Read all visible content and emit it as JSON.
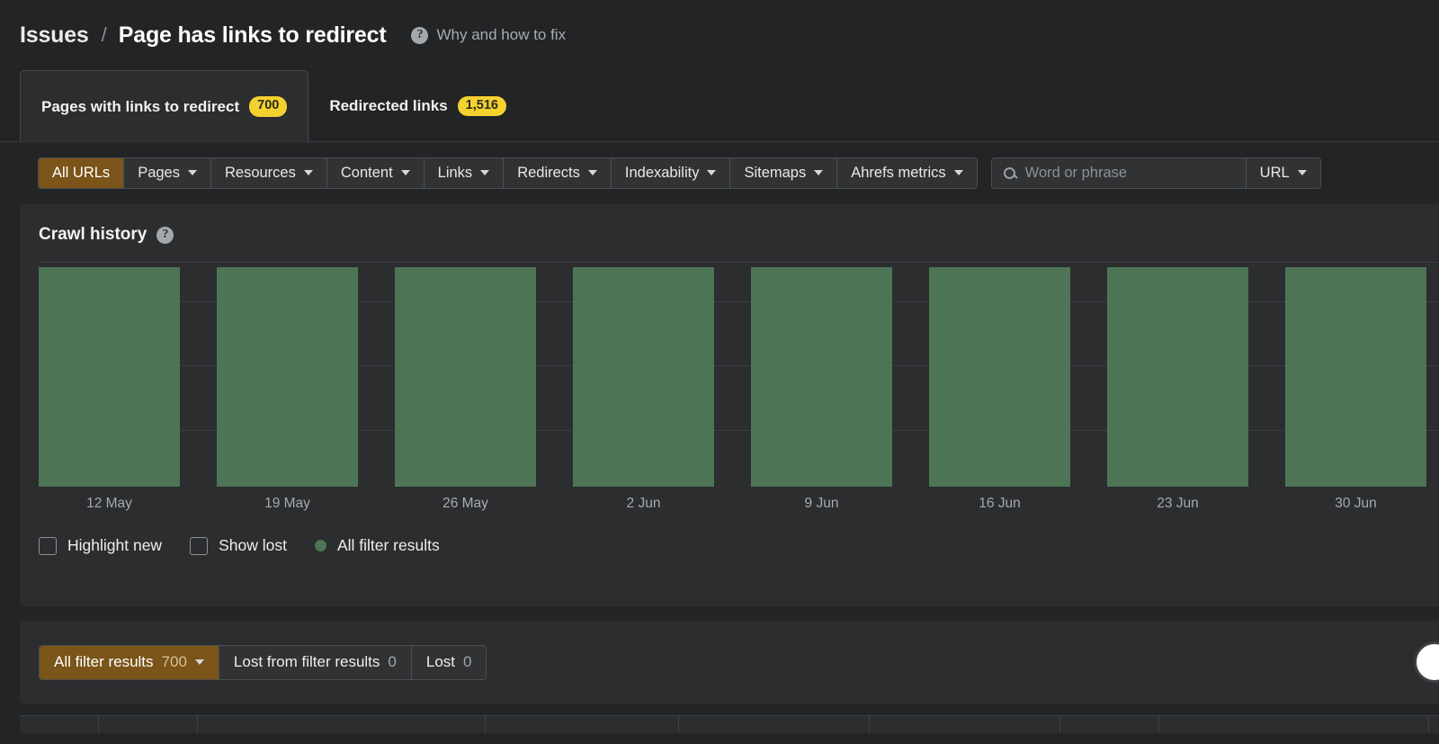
{
  "breadcrumb": {
    "root": "Issues",
    "separator": "/",
    "title": "Page has links to redirect",
    "help_icon": "question-mark-icon",
    "help_link": "Why and how to fix"
  },
  "tabs": [
    {
      "label": "Pages with links to redirect",
      "badge": "700",
      "active": true
    },
    {
      "label": "Redirected links",
      "badge": "1,516",
      "active": false
    }
  ],
  "filter_toolbar": {
    "segments": [
      {
        "label": "All URLs",
        "has_caret": false,
        "active": true
      },
      {
        "label": "Pages",
        "has_caret": true,
        "active": false
      },
      {
        "label": "Resources",
        "has_caret": true,
        "active": false
      },
      {
        "label": "Content",
        "has_caret": true,
        "active": false
      },
      {
        "label": "Links",
        "has_caret": true,
        "active": false
      },
      {
        "label": "Redirects",
        "has_caret": true,
        "active": false
      },
      {
        "label": "Indexability",
        "has_caret": true,
        "active": false
      },
      {
        "label": "Sitemaps",
        "has_caret": true,
        "active": false
      },
      {
        "label": "Ahrefs metrics",
        "has_caret": true,
        "active": false
      }
    ],
    "search": {
      "icon": "search-icon",
      "placeholder": "Word or phrase",
      "value": ""
    },
    "scope_selector": {
      "label": "URL",
      "has_caret": true
    }
  },
  "crawl_history": {
    "title": "Crawl history",
    "help_icon": "question-mark-icon",
    "legend": [
      {
        "type": "checkbox",
        "label": "Highlight new",
        "checked": false
      },
      {
        "type": "checkbox",
        "label": "Show lost",
        "checked": false
      },
      {
        "type": "dot",
        "label": "All filter results",
        "color": "#4d7555"
      }
    ]
  },
  "chart_data": {
    "type": "bar",
    "title": "Crawl history",
    "categories": [
      "12 May",
      "19 May",
      "26 May",
      "2 Jun",
      "9 Jun",
      "16 Jun",
      "23 Jun",
      "30 Jun"
    ],
    "series": [
      {
        "name": "All filter results",
        "color": "#4d7555",
        "values": [
          700,
          700,
          700,
          700,
          700,
          700,
          700,
          700
        ]
      }
    ],
    "xlabel": "",
    "ylabel": "",
    "ylim": [
      0,
      800
    ],
    "gridlines": [
      200,
      400,
      600
    ],
    "grid": true,
    "legend_position": "bottom-left"
  },
  "results_bar": {
    "segments": [
      {
        "label": "All filter results",
        "count": "700",
        "has_caret": true,
        "active": true
      },
      {
        "label": "Lost from filter results",
        "count": "0",
        "has_caret": false,
        "active": false
      },
      {
        "label": "Lost",
        "count": "0",
        "has_caret": false,
        "active": false
      }
    ],
    "help_button": "help-fab-button"
  }
}
